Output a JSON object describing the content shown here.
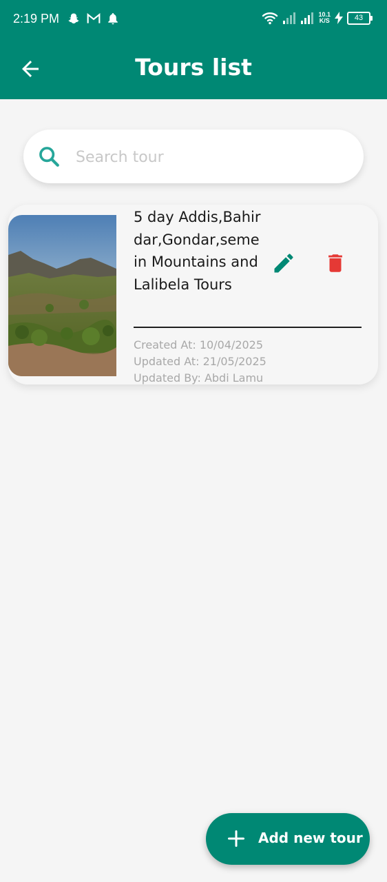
{
  "status_bar": {
    "time": "2:19 PM",
    "speed_top": "10.1",
    "speed_bottom": "K/S",
    "battery": "43",
    "notif_icons": [
      "snapchat-icon",
      "gmail-icon",
      "bell-icon"
    ],
    "right_icons": [
      "wifi-icon",
      "signal-1-icon",
      "signal-2-icon",
      "charging-icon",
      "battery-icon"
    ]
  },
  "app_bar": {
    "title": "Tours list",
    "back_icon": "arrow-back-icon"
  },
  "search": {
    "placeholder": "Search tour",
    "value": "",
    "icon": "search-icon"
  },
  "tours": [
    {
      "name": "5 day Addis,Bahirdar,Gondar,semein Mountains and Lalibela Tours",
      "created": "Created At: 10/04/2025",
      "updated": "Updated At: 21/05/2025",
      "updated_by": "Updated By: Abdi Lamu",
      "image": "mountain-landscape"
    }
  ],
  "fab": {
    "label": "Add new tour",
    "icon": "plus-icon"
  },
  "colors": {
    "primary": "#008874",
    "delete": "#e53935",
    "background": "#f5f5f5"
  }
}
